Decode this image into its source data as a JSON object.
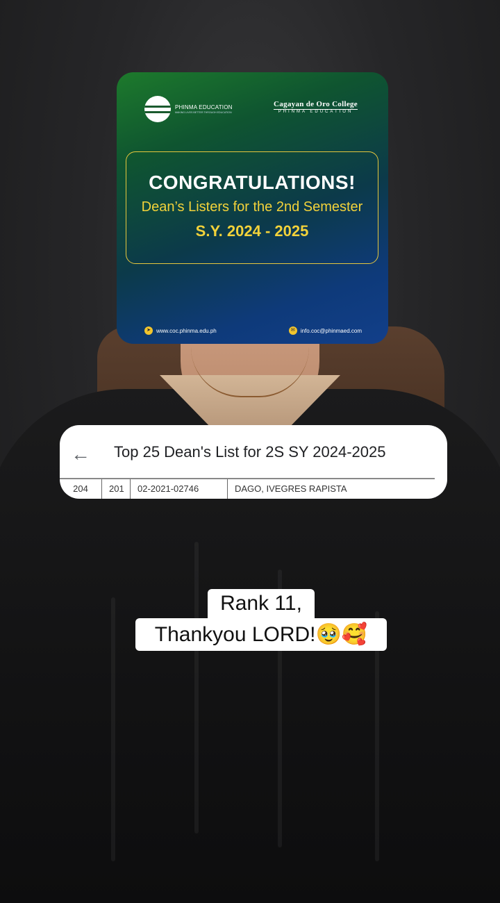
{
  "poster": {
    "left_brand": "PHINMA EDUCATION",
    "left_tagline": "MAKING LIVES BETTER THROUGH EDUCATION",
    "right_brand": "Cagayan de Oro College",
    "right_sub": "PHINMA EDUCATION",
    "headline": "CONGRATULATIONS!",
    "subtitle": "Dean’s Listers for the 2nd Semester",
    "school_year": "S.Y. 2024 - 2025",
    "website": "www.coc.phinma.edu.ph",
    "email": "info.coc@phinmaed.com",
    "colors": {
      "gold": "#f2d23a",
      "green": "#1d7a2c",
      "blue": "#123f8a"
    }
  },
  "strip": {
    "back_icon": "arrow-left",
    "title": "Top 25 Dean's List for 2S SY 2024-2025",
    "row": [
      "204",
      "201",
      "02-2021-02746",
      "DAGO, IVEGRES RAPISTA"
    ]
  },
  "caption": {
    "line1": "Rank 11,",
    "line2": "Thankyou LORD!🥹🥰"
  }
}
